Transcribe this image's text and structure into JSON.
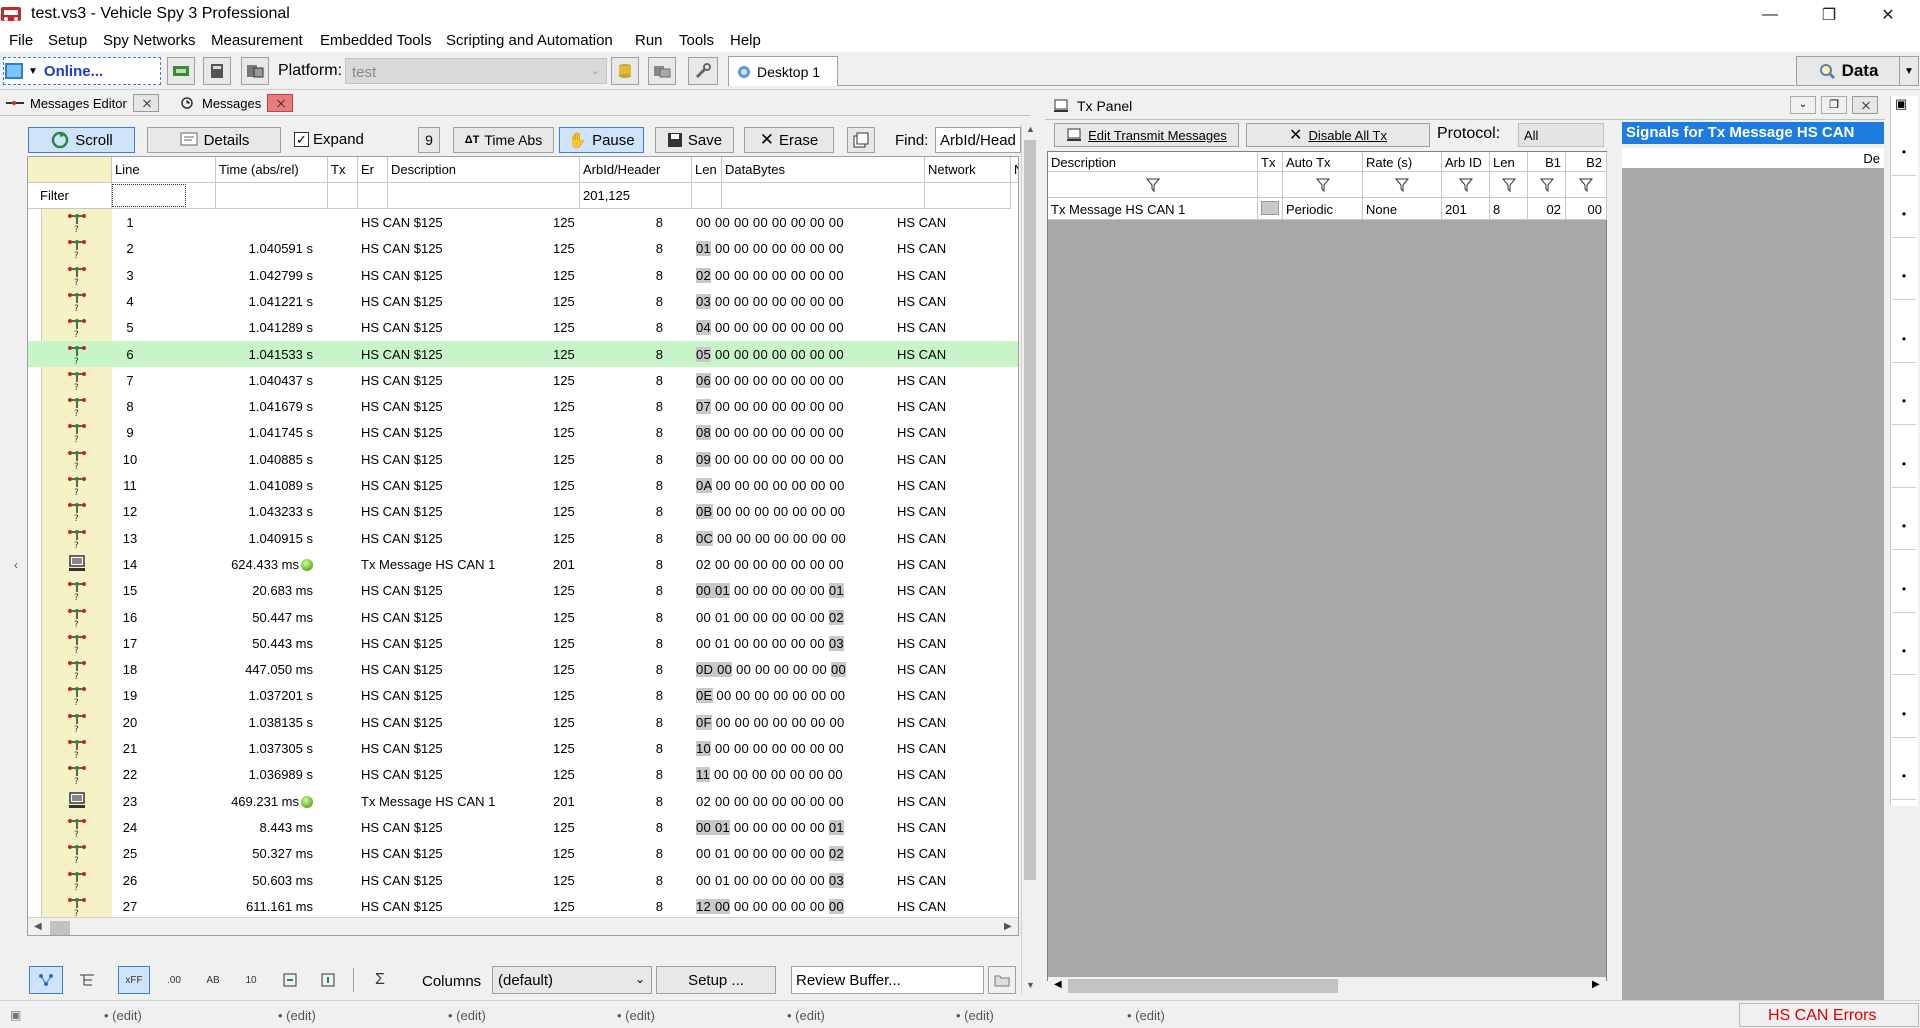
{
  "window": {
    "title": "test.vs3 - Vehicle Spy 3 Professional"
  },
  "menu": [
    "File",
    "Setup",
    "Spy Networks",
    "Measurement",
    "Embedded Tools",
    "Scripting and Automation",
    "Run",
    "Tools",
    "Help"
  ],
  "toolbar": {
    "online": "Online...",
    "platform_label": "Platform:",
    "platform_value": "test",
    "desktop_tab": "Desktop 1",
    "data_button": "Data"
  },
  "tabs": {
    "messages_editor": "Messages Editor",
    "messages": "Messages",
    "tx_panel": "Tx Panel"
  },
  "msgtoolbar": {
    "scroll": "Scroll",
    "details": "Details",
    "expand": "Expand",
    "time_abs": "Time Abs",
    "pause": "Pause",
    "save": "Save",
    "erase": "Erase",
    "find_label": "Find:",
    "find_value": "ArbId/Head"
  },
  "grid": {
    "columns": [
      "Line",
      "Time (abs/rel)",
      "Tx",
      "Er",
      "Description",
      "ArbId/Header",
      "Len",
      "DataBytes",
      "Network",
      "N"
    ],
    "filter_label": "Filter",
    "filter_arbid": "201,125",
    "rows": [
      {
        "line": "1",
        "time": "",
        "led": false,
        "desc": "HS CAN $125",
        "arb": "125",
        "len": "8",
        "data": [
          [
            "00 00 00 00 00 00 00 00",
            ""
          ]
        ],
        "net": "HS CAN",
        "icon": "rx"
      },
      {
        "line": "2",
        "time": "1.040591 s",
        "led": false,
        "desc": "HS CAN $125",
        "arb": "125",
        "len": "8",
        "data": [
          [
            "01",
            "h"
          ],
          [
            " 00 00 00 00 00 00 00",
            ""
          ]
        ],
        "net": "HS CAN",
        "icon": "rx"
      },
      {
        "line": "3",
        "time": "1.042799 s",
        "led": false,
        "desc": "HS CAN $125",
        "arb": "125",
        "len": "8",
        "data": [
          [
            "02",
            "h"
          ],
          [
            " 00 00 00 00 00 00 00",
            ""
          ]
        ],
        "net": "HS CAN",
        "icon": "rx"
      },
      {
        "line": "4",
        "time": "1.041221 s",
        "led": false,
        "desc": "HS CAN $125",
        "arb": "125",
        "len": "8",
        "data": [
          [
            "03",
            "h"
          ],
          [
            " 00 00 00 00 00 00 00",
            ""
          ]
        ],
        "net": "HS CAN",
        "icon": "rx"
      },
      {
        "line": "5",
        "time": "1.041289 s",
        "led": false,
        "desc": "HS CAN $125",
        "arb": "125",
        "len": "8",
        "data": [
          [
            "04",
            "h"
          ],
          [
            " 00 00 00 00 00 00 00",
            ""
          ]
        ],
        "net": "HS CAN",
        "icon": "rx"
      },
      {
        "line": "6",
        "time": "1.041533 s",
        "led": false,
        "desc": "HS CAN $125",
        "arb": "125",
        "len": "8",
        "data": [
          [
            "05",
            "h"
          ],
          [
            " 00 00 00 00 00 00 00",
            ""
          ]
        ],
        "net": "HS CAN",
        "icon": "rx",
        "selected": true
      },
      {
        "line": "7",
        "time": "1.040437 s",
        "led": false,
        "desc": "HS CAN $125",
        "arb": "125",
        "len": "8",
        "data": [
          [
            "06",
            "h"
          ],
          [
            " 00 00 00 00 00 00 00",
            ""
          ]
        ],
        "net": "HS CAN",
        "icon": "rx"
      },
      {
        "line": "8",
        "time": "1.041679 s",
        "led": false,
        "desc": "HS CAN $125",
        "arb": "125",
        "len": "8",
        "data": [
          [
            "07",
            "h"
          ],
          [
            " 00 00 00 00 00 00 00",
            ""
          ]
        ],
        "net": "HS CAN",
        "icon": "rx"
      },
      {
        "line": "9",
        "time": "1.041745 s",
        "led": false,
        "desc": "HS CAN $125",
        "arb": "125",
        "len": "8",
        "data": [
          [
            "08",
            "h"
          ],
          [
            " 00 00 00 00 00 00 00",
            ""
          ]
        ],
        "net": "HS CAN",
        "icon": "rx"
      },
      {
        "line": "10",
        "time": "1.040885 s",
        "led": false,
        "desc": "HS CAN $125",
        "arb": "125",
        "len": "8",
        "data": [
          [
            "09",
            "h"
          ],
          [
            " 00 00 00 00 00 00 00",
            ""
          ]
        ],
        "net": "HS CAN",
        "icon": "rx"
      },
      {
        "line": "11",
        "time": "1.041089 s",
        "led": false,
        "desc": "HS CAN $125",
        "arb": "125",
        "len": "8",
        "data": [
          [
            "0A",
            "h"
          ],
          [
            " 00 00 00 00 00 00 00",
            ""
          ]
        ],
        "net": "HS CAN",
        "icon": "rx"
      },
      {
        "line": "12",
        "time": "1.043233 s",
        "led": false,
        "desc": "HS CAN $125",
        "arb": "125",
        "len": "8",
        "data": [
          [
            "0B",
            "h"
          ],
          [
            " 00 00 00 00 00 00 00",
            ""
          ]
        ],
        "net": "HS CAN",
        "icon": "rx"
      },
      {
        "line": "13",
        "time": "1.040915 s",
        "led": false,
        "desc": "HS CAN $125",
        "arb": "125",
        "len": "8",
        "data": [
          [
            "0C",
            "h"
          ],
          [
            " 00 00 00 00 00 00 00",
            ""
          ]
        ],
        "net": "HS CAN",
        "icon": "rx"
      },
      {
        "line": "14",
        "time": "624.433 ms",
        "led": true,
        "desc": "Tx Message HS CAN 1",
        "arb": "201",
        "len": "8",
        "data": [
          [
            "02 00 00 00 00 00 00 00",
            ""
          ]
        ],
        "net": "HS CAN",
        "icon": "tx"
      },
      {
        "line": "15",
        "time": "20.683 ms",
        "led": false,
        "desc": "HS CAN $125",
        "arb": "125",
        "len": "8",
        "data": [
          [
            "00 01",
            "h"
          ],
          [
            " 00 00 00 00 00 ",
            ""
          ],
          [
            "01",
            "h"
          ]
        ],
        "net": "HS CAN",
        "icon": "rx"
      },
      {
        "line": "16",
        "time": "50.447 ms",
        "led": false,
        "desc": "HS CAN $125",
        "arb": "125",
        "len": "8",
        "data": [
          [
            "00 01 00 00 00 00 00 ",
            ""
          ],
          [
            "02",
            "h"
          ]
        ],
        "net": "HS CAN",
        "icon": "rx"
      },
      {
        "line": "17",
        "time": "50.443 ms",
        "led": false,
        "desc": "HS CAN $125",
        "arb": "125",
        "len": "8",
        "data": [
          [
            "00 01 00 00 00 00 00 ",
            ""
          ],
          [
            "03",
            "h"
          ]
        ],
        "net": "HS CAN",
        "icon": "rx"
      },
      {
        "line": "18",
        "time": "447.050 ms",
        "led": false,
        "desc": "HS CAN $125",
        "arb": "125",
        "len": "8",
        "data": [
          [
            "0D 00",
            "h"
          ],
          [
            " 00 00 00 00 00 ",
            ""
          ],
          [
            "00",
            "h"
          ]
        ],
        "net": "HS CAN",
        "icon": "rx"
      },
      {
        "line": "19",
        "time": "1.037201 s",
        "led": false,
        "desc": "HS CAN $125",
        "arb": "125",
        "len": "8",
        "data": [
          [
            "0E",
            "h"
          ],
          [
            " 00 00 00 00 00 00 00",
            ""
          ]
        ],
        "net": "HS CAN",
        "icon": "rx"
      },
      {
        "line": "20",
        "time": "1.038135 s",
        "led": false,
        "desc": "HS CAN $125",
        "arb": "125",
        "len": "8",
        "data": [
          [
            "0F",
            "h"
          ],
          [
            " 00 00 00 00 00 00 00",
            ""
          ]
        ],
        "net": "HS CAN",
        "icon": "rx"
      },
      {
        "line": "21",
        "time": "1.037305 s",
        "led": false,
        "desc": "HS CAN $125",
        "arb": "125",
        "len": "8",
        "data": [
          [
            "10",
            "h"
          ],
          [
            " 00 00 00 00 00 00 00",
            ""
          ]
        ],
        "net": "HS CAN",
        "icon": "rx"
      },
      {
        "line": "22",
        "time": "1.036989 s",
        "led": false,
        "desc": "HS CAN $125",
        "arb": "125",
        "len": "8",
        "data": [
          [
            "11",
            "h"
          ],
          [
            " 00 00 00 00 00 00 00",
            ""
          ]
        ],
        "net": "HS CAN",
        "icon": "rx"
      },
      {
        "line": "23",
        "time": "469.231 ms",
        "led": true,
        "desc": "Tx Message HS CAN 1",
        "arb": "201",
        "len": "8",
        "data": [
          [
            "02 00 00 00 00 00 00 00",
            ""
          ]
        ],
        "net": "HS CAN",
        "icon": "tx"
      },
      {
        "line": "24",
        "time": "8.443 ms",
        "led": false,
        "desc": "HS CAN $125",
        "arb": "125",
        "len": "8",
        "data": [
          [
            "00 01",
            "h"
          ],
          [
            " 00 00 00 00 00 ",
            ""
          ],
          [
            "01",
            "h"
          ]
        ],
        "net": "HS CAN",
        "icon": "rx"
      },
      {
        "line": "25",
        "time": "50.327 ms",
        "led": false,
        "desc": "HS CAN $125",
        "arb": "125",
        "len": "8",
        "data": [
          [
            "00 01 00 00 00 00 00 ",
            ""
          ],
          [
            "02",
            "h"
          ]
        ],
        "net": "HS CAN",
        "icon": "rx"
      },
      {
        "line": "26",
        "time": "50.603 ms",
        "led": false,
        "desc": "HS CAN $125",
        "arb": "125",
        "len": "8",
        "data": [
          [
            "00 01 00 00 00 00 00 ",
            ""
          ],
          [
            "03",
            "h"
          ]
        ],
        "net": "HS CAN",
        "icon": "rx"
      },
      {
        "line": "27",
        "time": "611.161 ms",
        "led": false,
        "desc": "HS CAN $125",
        "arb": "125",
        "len": "8",
        "data": [
          [
            "12 00",
            "h"
          ],
          [
            " 00 00 00 00 00 ",
            ""
          ],
          [
            "00",
            "h"
          ]
        ],
        "net": "HS CAN",
        "icon": "rx"
      }
    ]
  },
  "bottombar": {
    "columns_label": "Columns",
    "columns_value": "(default)",
    "setup": "Setup ...",
    "review": "Review Buffer...",
    "fmt_hex": "xFF",
    "fmt_dec": ".00",
    "fmt_ab": "AB",
    "fmt_10": "10"
  },
  "txpanel": {
    "edit": "Edit Transmit Messages",
    "disable": "Disable All Tx",
    "protocol_label": "Protocol:",
    "protocol_value": "All",
    "columns": [
      "Description",
      "Tx",
      "Auto Tx",
      "Rate (s)",
      "Arb ID",
      "Len",
      "B1",
      "B2"
    ],
    "row": {
      "description": "Tx Message HS CAN 1",
      "autotx": "Periodic",
      "rate": "None",
      "arbid": "201",
      "len": "8",
      "b1": "02",
      "b2": "00"
    },
    "signals_title": "Signals for Tx Message HS CAN",
    "signals_col": "De"
  },
  "status": {
    "edit": "(edit)",
    "error": "HS CAN Errors"
  }
}
